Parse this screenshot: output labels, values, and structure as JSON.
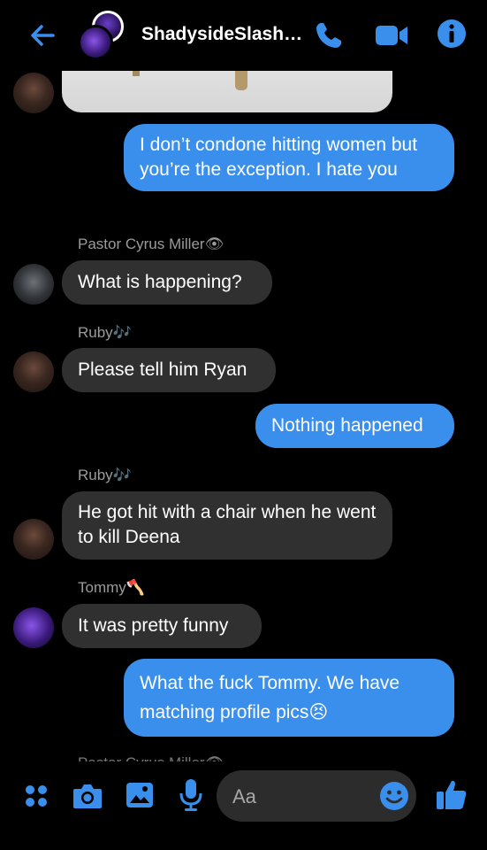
{
  "header": {
    "title": "ShadysideSlash…",
    "icons": [
      "back-arrow-icon",
      "phone-icon",
      "video-camera-icon",
      "info-icon"
    ]
  },
  "colors": {
    "accent": "#3a8fec",
    "incoming_bubble": "#303030",
    "background": "#000000"
  },
  "messages": [
    {
      "direction": "incoming",
      "sender": "",
      "type": "image"
    },
    {
      "direction": "outgoing",
      "text": "I don’t condone hitting women but you’re the exception. I hate you"
    },
    {
      "direction": "incoming",
      "sender": "Pastor Cyrus Miller👁",
      "text": "What is happening?"
    },
    {
      "direction": "incoming",
      "sender": "Ruby🎶",
      "text": "Please tell him Ryan"
    },
    {
      "direction": "outgoing",
      "text": "Nothing happened"
    },
    {
      "direction": "incoming",
      "sender": "Ruby🎶",
      "text": "He got hit with a chair when he went to kill Deena"
    },
    {
      "direction": "incoming",
      "sender": "Tommy🪓",
      "text": "It was pretty funny"
    },
    {
      "direction": "outgoing",
      "text": "What the fuck Tommy. We have matching profile pics😣"
    },
    {
      "direction": "incoming",
      "sender": "Pastor Cyrus Miller👁",
      "partial": true
    }
  ],
  "composer": {
    "placeholder": "Aa",
    "icons": [
      "apps-grid-icon",
      "camera-icon",
      "gallery-icon",
      "microphone-icon",
      "emoji-icon",
      "thumbs-up-icon"
    ]
  }
}
